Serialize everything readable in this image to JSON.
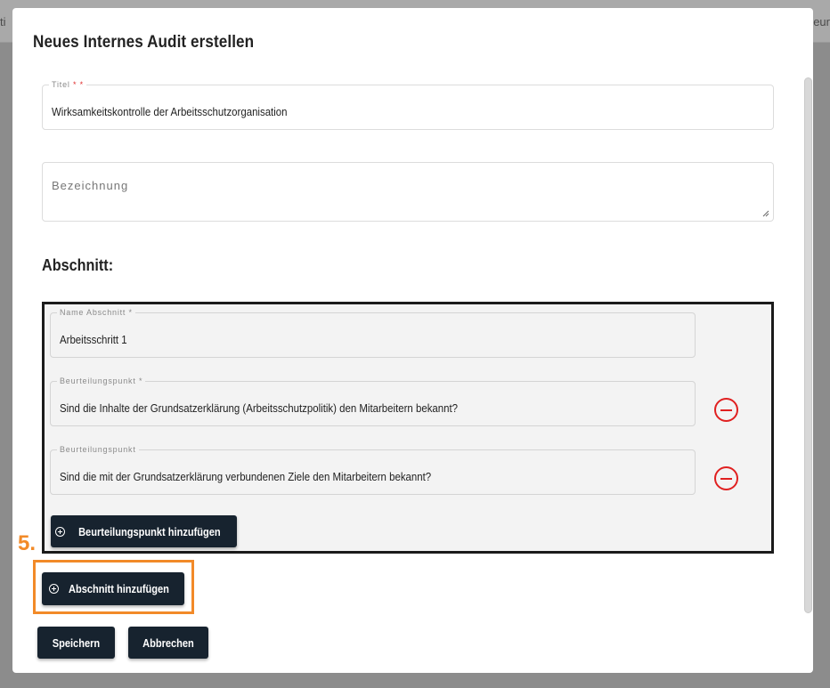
{
  "background": {
    "left_tab_fragment": "ti",
    "right_tab_fragment": "eur"
  },
  "modal": {
    "title": "Neues Internes Audit erstellen"
  },
  "title_field": {
    "label": "Titel",
    "required_marker": "* *",
    "value": "Wirksamkeitskontrolle der Arbeitsschutzorganisation"
  },
  "description_field": {
    "placeholder": "Bezeichnung"
  },
  "section": {
    "heading": "Abschnitt:",
    "name_field": {
      "label": "Name Abschnitt *",
      "value": "Arbeitsschritt 1"
    },
    "points": [
      {
        "label": "Beurteilungspunkt *",
        "value": "Sind die Inhalte der Grundsatzerklärung (Arbeitsschutzpolitik) den Mitarbeitern bekannt?"
      },
      {
        "label": "Beurteilungspunkt",
        "value": "Sind die mit der Grundsatzerklärung verbundenen Ziele den Mitarbeitern bekannt?"
      }
    ],
    "add_point_label": "Beurteilungspunkt hinzufügen"
  },
  "add_section_label": "Abschnitt hinzufügen",
  "annotation": {
    "step_number": "5.",
    "color": "#f28a28"
  },
  "footer": {
    "save_label": "Speichern",
    "cancel_label": "Abbrechen"
  },
  "colors": {
    "button_bg": "#17232f",
    "remove_red": "#e02020"
  },
  "icons": [
    "plus-circle-icon",
    "minus-circle-icon",
    "resize-handle-icon"
  ]
}
